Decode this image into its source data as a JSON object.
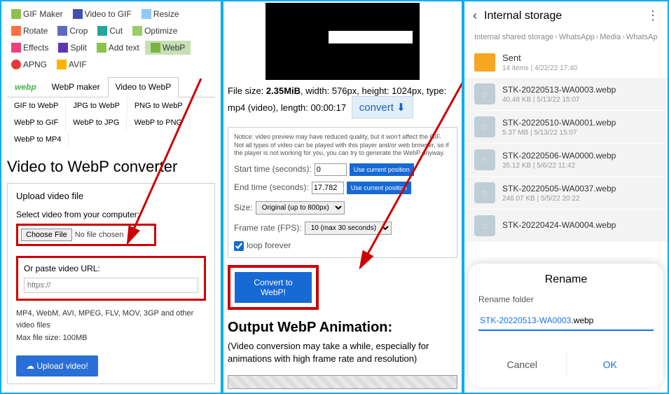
{
  "panel1": {
    "tools_row1": [
      "GIF Maker",
      "Video to GIF",
      "Resize"
    ],
    "tools_row2": [
      "Rotate",
      "Crop",
      "Cut",
      "Optimize"
    ],
    "tools_row3": [
      "Effects",
      "Split",
      "Add text",
      "WebP"
    ],
    "tools_row4": [
      "APNG",
      "AVIF"
    ],
    "brand": "webp",
    "tabs": [
      "WebP maker",
      "Video to WebP"
    ],
    "subtabs_row1": [
      "GIF to WebP",
      "JPG to WebP",
      "PNG to WebP"
    ],
    "subtabs_row2": [
      "WebP to GIF",
      "WebP to JPG",
      "WebP to PNG"
    ],
    "subtabs_row3": [
      "WebP to MP4"
    ],
    "page_title": "Video to WebP converter",
    "upload_heading": "Upload video file",
    "select_label": "Select video from your computer:",
    "choose_file": "Choose File",
    "no_file": "No file chosen",
    "url_label": "Or paste video URL:",
    "url_placeholder": "https://",
    "help1": "MP4, WebM, AVI, MPEG, FLV, MOV, 3GP and other video files",
    "help2": "Max file size: 100MB",
    "upload_btn": "Upload video!"
  },
  "panel2": {
    "meta_prefix": "File size: ",
    "meta_size": "2.35MiB",
    "meta_rest": ", width: 576px, height: 1024px, type: mp4 (video), length: 00:00:17",
    "convert_pill": "convert",
    "notice": "Notice: video preview may have reduced quality, but it won't affect the GIF. Not all types of video can be played with this player and/or web browser, so if the player is not working for you, you can try to generate the WebP anyway.",
    "start_label": "Start time (seconds):",
    "start_val": "0",
    "end_label": "End time (seconds):",
    "end_val": "17.782",
    "pos_btn": "Use current position",
    "size_label": "Size:",
    "size_val": "Original (up to 800px)",
    "fps_label": "Frame rate (FPS):",
    "fps_val": "10 (max 30 seconds)",
    "loop_label": "loop forever",
    "convert_btn": "Convert to WebP!",
    "out_title": "Output WebP Animation:",
    "out_text": "(Video conversion may take a while, especially for animations with high frame rate and resolution)"
  },
  "panel3": {
    "title": "Internal storage",
    "breadcrumb": [
      "Internal shared storage",
      "WhatsApp",
      "Media",
      "WhatsAp"
    ],
    "folder": {
      "name": "Sent",
      "meta": "14 items | 4/22/22 17:40"
    },
    "files": [
      {
        "name": "STK-20220513-WA0003.webp",
        "meta": "40.48 KB | 5/13/22 15:07"
      },
      {
        "name": "STK-20220510-WA0001.webp",
        "meta": "5.37 MB | 5/13/22 15:07"
      },
      {
        "name": "STK-20220506-WA0000.webp",
        "meta": "35.12 KB | 5/6/22 11:42"
      },
      {
        "name": "STK-20220505-WA0037.webp",
        "meta": "246.07 KB | 5/5/22 20:22"
      },
      {
        "name": "STK-20220424-WA0004.webp",
        "meta": ""
      }
    ],
    "rename_title": "Rename",
    "rename_label": "Rename folder",
    "rename_value_blue": "STK-20220513-WA0003",
    "rename_value_ext": ".webp",
    "cancel": "Cancel",
    "ok": "OK"
  }
}
